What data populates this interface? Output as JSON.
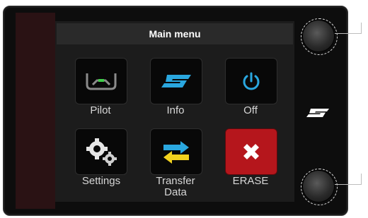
{
  "header": {
    "title": "Main menu"
  },
  "menu": {
    "items": [
      {
        "label": "Pilot",
        "icon": "pilot-wheel-icon"
      },
      {
        "label": "Info",
        "icon": "brand-s-logo-icon"
      },
      {
        "label": "Off",
        "icon": "power-icon"
      },
      {
        "label": "Settings",
        "icon": "gears-icon"
      },
      {
        "label_line1": "Transfer",
        "label_line2": "Data",
        "icon": "transfer-arrows-icon"
      },
      {
        "label": "ERASE",
        "icon": "erase-x-icon"
      }
    ]
  },
  "device": {
    "knobs": [
      "upper-knob",
      "lower-knob"
    ],
    "brand_icon": "brand-s-logo-icon"
  },
  "colors": {
    "accent_blue": "#2aa7df",
    "erase_red": "#b5161c",
    "transfer_yellow": "#f2d21e",
    "pilot_green": "#3fd04a"
  }
}
